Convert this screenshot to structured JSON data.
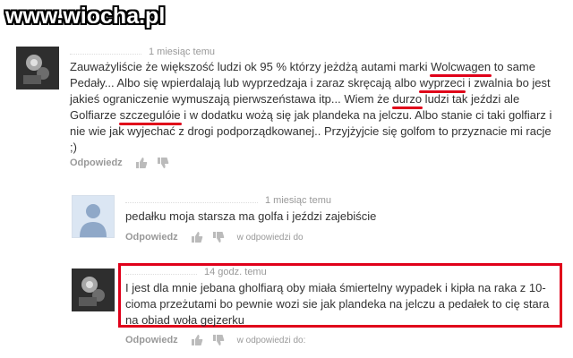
{
  "watermark": "www.wiocha.pl",
  "comments": [
    {
      "time": "1 miesiąc temu",
      "text_parts": [
        {
          "t": "Zauważyliście że większość ludzi ok 95 % którzy jeżdżą autami marki ",
          "hl": false
        },
        {
          "t": "Wolcwagen",
          "hl": true
        },
        {
          "t": " to same Pedały... Albo się wpierdalają lub wyprzedzaja i zaraz skręcają albo ",
          "hl": false
        },
        {
          "t": "wyprzeci",
          "hl": true
        },
        {
          "t": " i zwalnia bo jest jakieś ograniczenie wymuszają pierwszeństawa itp... Wiem że ",
          "hl": false
        },
        {
          "t": "durzo",
          "hl": true
        },
        {
          "t": " ludzi tak jeździ ale Golfiarze ",
          "hl": false
        },
        {
          "t": "szczegulóie",
          "hl": true
        },
        {
          "t": " i w dodatku wożą się jak plandeka na jelczu. Albo stanie ci taki golfiarz i nie wie jak wyjechać z drogi podporządkowanej.. Przyjżyjcie się golfom to przyznacie mi racje ;)",
          "hl": false
        }
      ],
      "reply_label": "Odpowiedz"
    },
    {
      "time": "1 miesiąc temu",
      "text": "pedałku moja starsza ma golfa i jeździ zajebiście",
      "reply_label": "Odpowiedz",
      "in_reply": "w odpowiedzi do"
    },
    {
      "time": "14 godz. temu",
      "text": "I jest dla mnie jebana gholfiarą oby miała śmiertelny wypadek i kipła na raka z 10-cioma przeżutami bo pewnie wozi sie jak plandeka na jelczu a pedałek to cię stara na obiad woła gejzerku",
      "reply_label": "Odpowiedz",
      "in_reply": "w odpowiedzi do:"
    }
  ],
  "colors": {
    "highlight": "#e0001a",
    "link": "#999999"
  },
  "icons": [
    "thumb-up-icon",
    "thumb-down-icon",
    "default-avatar-icon"
  ]
}
